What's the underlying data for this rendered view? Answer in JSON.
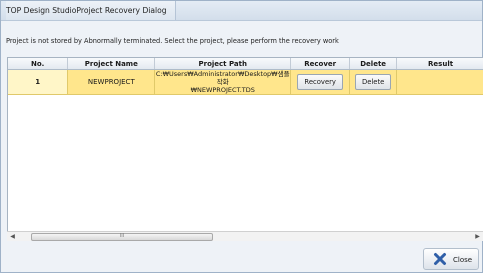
{
  "window": {
    "title": "TOP Design StudioProject Recovery Dialog"
  },
  "message": "Project is not stored by Abnormally terminated. Select the project, please perform the recovery work",
  "table": {
    "columns": [
      "No.",
      "Project Name",
      "Project Path",
      "Recover",
      "Delete",
      "Result"
    ],
    "rows": [
      {
        "no": "1",
        "name": "NEWPROJECT",
        "path_line1": "C:₩Users₩Administrator₩Desktop₩샘플작화",
        "path_line2": "₩NEWPROJECT.TDS",
        "recover_label": "Recovery",
        "delete_label": "Delete",
        "result": ""
      }
    ]
  },
  "scrollbar": {
    "thumb_grip": "III"
  },
  "footer": {
    "close_label": "Close",
    "close_icon": "x-icon"
  },
  "colors": {
    "row_highlight": "#ffe68c",
    "close_icon": "#2f5fa8"
  }
}
